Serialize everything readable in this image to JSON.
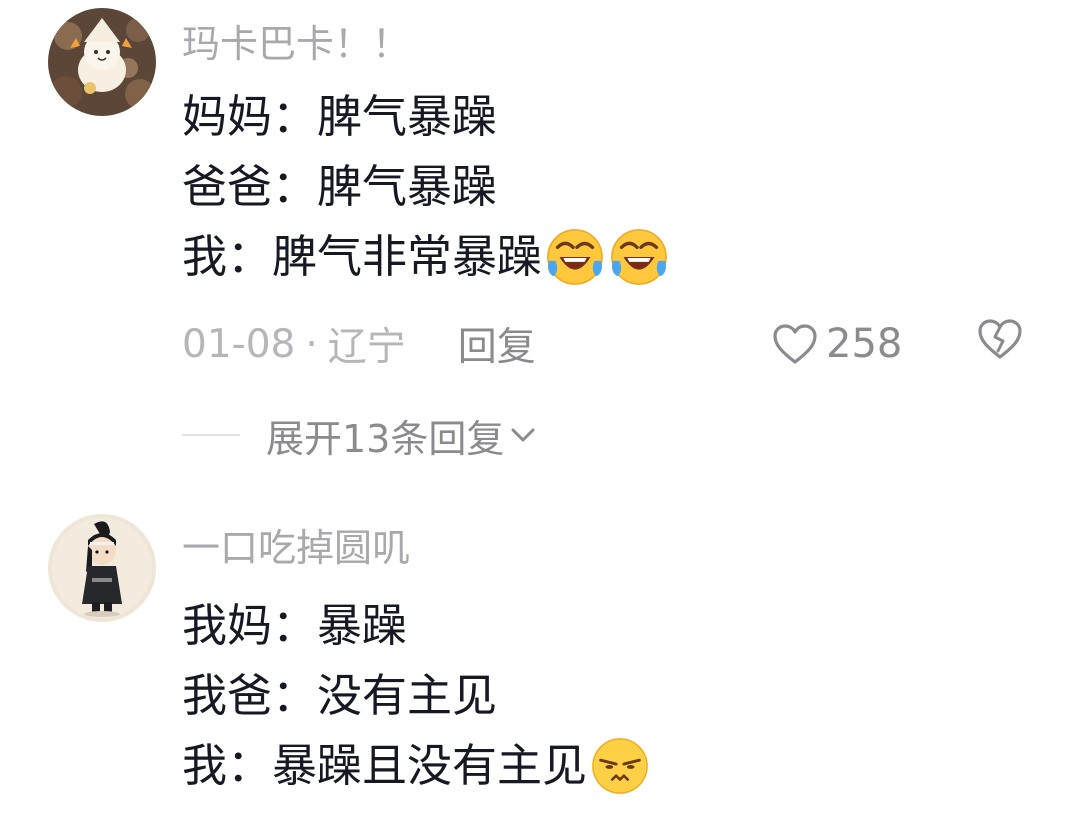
{
  "comments": [
    {
      "username": "玛卡巴卡！！",
      "avatar_icon": "cat-avatar-icon",
      "lines": [
        {
          "text": "妈妈：脾气暴躁"
        },
        {
          "text": "爸爸：脾气暴躁"
        },
        {
          "text": "我：脾气非常暴躁",
          "emojis": [
            "laugh-cry-emoji-icon",
            "laugh-cry-emoji-icon"
          ]
        }
      ],
      "date": "01-08",
      "dot": "·",
      "location": "辽宁",
      "reply_label": "回复",
      "like_count": "258",
      "expand_label": "展开13条回复"
    },
    {
      "username": "一口吃掉圆叽",
      "avatar_icon": "character-avatar-icon",
      "lines": [
        {
          "text": "我妈：暴躁"
        },
        {
          "text": "我爸：没有主见"
        },
        {
          "text": "我：暴躁且没有主见",
          "emojis": [
            "smirk-emoji-icon"
          ]
        }
      ]
    }
  ],
  "colors": {
    "text": "#161823",
    "username": "#a8a8ad",
    "meta": "#b6b6ba",
    "action": "#8a8a8f"
  }
}
